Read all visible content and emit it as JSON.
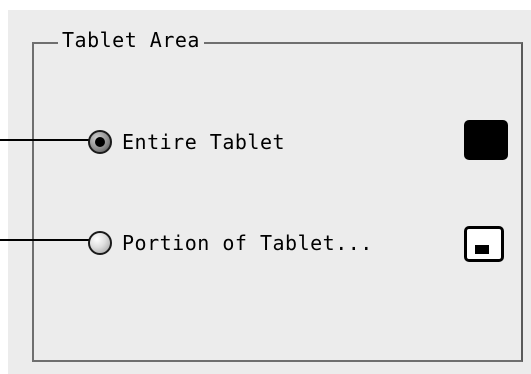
{
  "group": {
    "title": "Tablet Area"
  },
  "options": [
    {
      "label": "Entire Tablet",
      "selected": true,
      "icon": "full-area-icon"
    },
    {
      "label": "Portion of Tablet...",
      "selected": false,
      "icon": "portion-area-icon"
    }
  ],
  "colors": {
    "panel_background": "#ececec",
    "border": "#6f6f6f",
    "text": "#000000"
  }
}
